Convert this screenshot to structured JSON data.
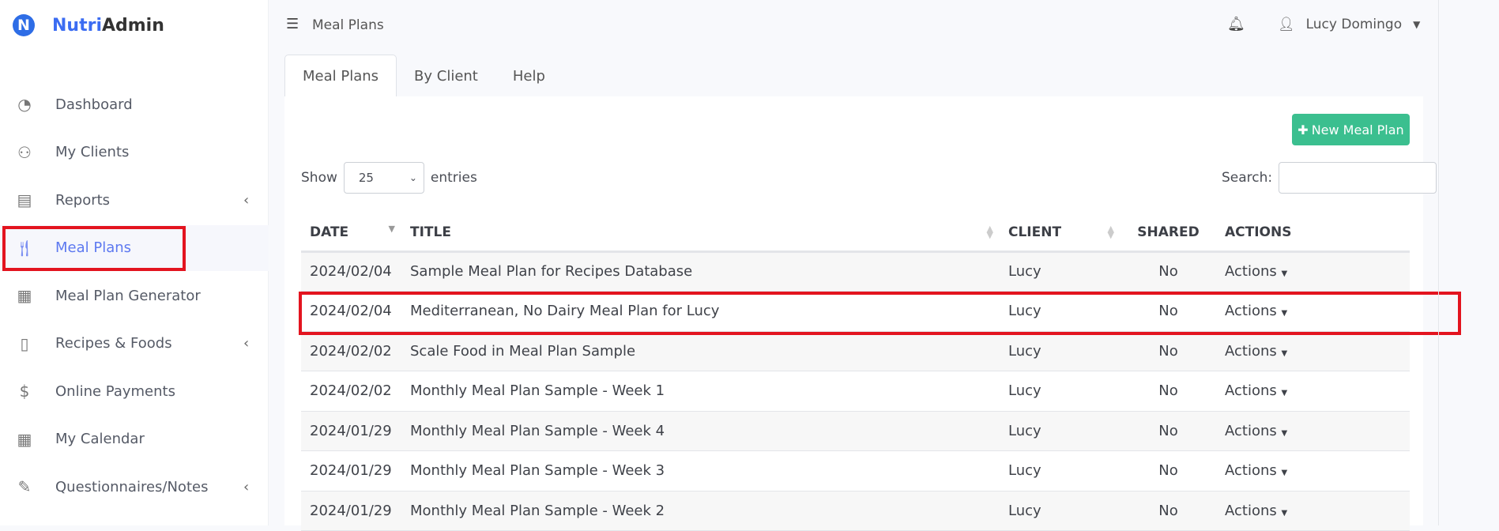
{
  "app": {
    "logo_letter": "N",
    "brand_a": "Nutri",
    "brand_b": "Admin"
  },
  "sidebar": {
    "items": [
      {
        "label": "Dashboard",
        "icon": "dashboard-gauge-icon"
      },
      {
        "label": "My Clients",
        "icon": "users-icon"
      },
      {
        "label": "Reports",
        "icon": "report-icon",
        "submenu": true
      },
      {
        "label": "Meal Plans",
        "icon": "utensils-icon",
        "active": true
      },
      {
        "label": "Meal Plan Generator",
        "icon": "generator-icon"
      },
      {
        "label": "Recipes & Foods",
        "icon": "recipe-book-icon",
        "submenu": true
      },
      {
        "label": "Online Payments",
        "icon": "money-icon"
      },
      {
        "label": "My Calendar",
        "icon": "calendar-icon"
      },
      {
        "label": "Questionnaires/Notes",
        "icon": "edit-note-icon",
        "submenu": true
      }
    ]
  },
  "header": {
    "breadcrumb": "Meal Plans",
    "user": "Lucy Domingo"
  },
  "tabs": [
    "Meal Plans",
    "By Client",
    "Help"
  ],
  "toolbar": {
    "new_button": "New Meal Plan",
    "show_label": "Show",
    "entries_value": "25",
    "entries_label": "entries",
    "search_label": "Search:",
    "search_value": ""
  },
  "table": {
    "headers": [
      "DATE",
      "TITLE",
      "CLIENT",
      "SHARED",
      "ACTIONS"
    ],
    "rows": [
      [
        "2024/02/04",
        "Sample Meal Plan for Recipes Database",
        "Lucy",
        "No",
        "Actions"
      ],
      [
        "2024/02/04",
        "Mediterranean, No Dairy Meal Plan for Lucy",
        "Lucy",
        "No",
        "Actions"
      ],
      [
        "2024/02/02",
        "Scale Food in Meal Plan Sample",
        "Lucy",
        "No",
        "Actions"
      ],
      [
        "2024/02/02",
        "Monthly Meal Plan Sample - Week 1",
        "Lucy",
        "No",
        "Actions"
      ],
      [
        "2024/01/29",
        "Monthly Meal Plan Sample - Week 4",
        "Lucy",
        "No",
        "Actions"
      ],
      [
        "2024/01/29",
        "Monthly Meal Plan Sample - Week 3",
        "Lucy",
        "No",
        "Actions"
      ],
      [
        "2024/01/29",
        "Monthly Meal Plan Sample - Week 2",
        "Lucy",
        "No",
        "Actions"
      ]
    ]
  },
  "colors": {
    "accent": "#3b6cf2",
    "button": "#3bbf8f",
    "highlight": "#e3141f"
  }
}
